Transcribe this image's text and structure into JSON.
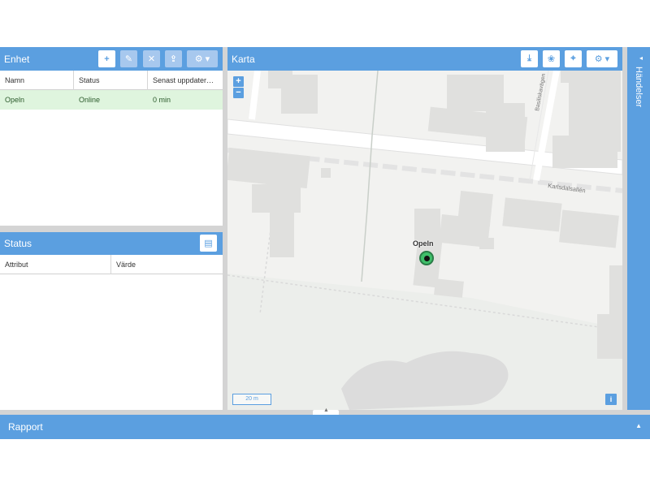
{
  "enhet": {
    "title": "Enhet",
    "columns": [
      "Namn",
      "Status",
      "Senast uppdater…"
    ],
    "rows": [
      {
        "name": "Opeln",
        "status": "Online",
        "updated": "0 min"
      }
    ]
  },
  "status": {
    "title": "Status",
    "columns": [
      "Attribut",
      "Värde"
    ]
  },
  "karta": {
    "title": "Karta",
    "zoom_in": "+",
    "zoom_out": "−",
    "scale": "20 m",
    "street_1": "Basiliskavägen",
    "street_2": "Karlsdalsallén",
    "marker_label": "Opeln",
    "info": "i"
  },
  "handelser": {
    "title": "Händelser"
  },
  "rapport": {
    "title": "Rapport"
  },
  "colors": {
    "accent": "#5b9fe0",
    "online_row": "#dff5de",
    "marker": "#3fbf6a"
  },
  "icons": [
    "plus-icon",
    "pencil-icon",
    "close-icon",
    "upload-icon",
    "gear-icon",
    "download-icon",
    "paw-icon",
    "crosshair-icon",
    "columns-icon"
  ]
}
